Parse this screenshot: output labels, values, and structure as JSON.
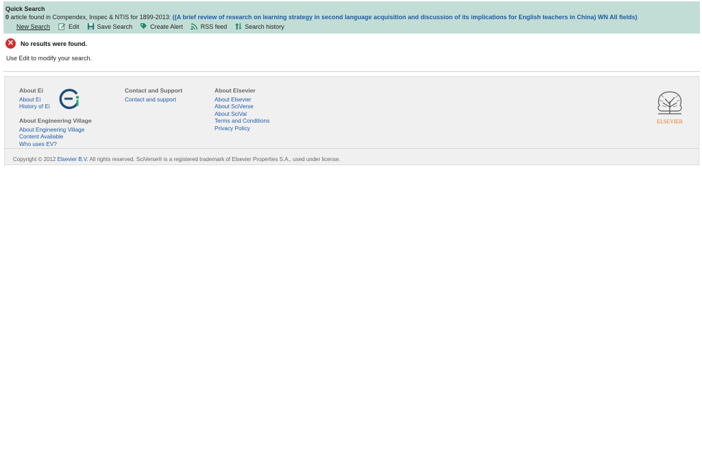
{
  "header": {
    "title": "Quick Search",
    "count": "0",
    "summary_text": " article found in Compendex, Inspec & NTIS for 1899-2013: ",
    "query": "((A brief review of research on learning strategy in second language acquisition and discussion of its implications for English teachers in China) WN All fields)"
  },
  "toolbar": {
    "new_search": "New Search",
    "edit": "Edit",
    "save_search": "Save Search",
    "create_alert": "Create Alert",
    "rss_feed": "RSS feed",
    "search_history": "Search history"
  },
  "message": {
    "error": "No results were found.",
    "hint": "Use Edit to modify your search."
  },
  "footer": {
    "about_ei": {
      "heading": "About Ei",
      "links": [
        "About Ei",
        "History of Ei"
      ]
    },
    "about_ev": {
      "heading": "About Engineering Village",
      "links": [
        "About Engineering Village",
        "Content Available",
        "Who uses EV?"
      ]
    },
    "contact": {
      "heading": "Contact and Support",
      "links": [
        "Contact and support"
      ]
    },
    "about_elsevier": {
      "heading": "About Elsevier",
      "links": [
        "About Elsevier",
        "About SciVerse",
        "About SciVal",
        "Terms and Conditions",
        "Privacy Policy"
      ]
    },
    "elsevier_logo_text": "ELSEVIER",
    "copyright_pre": "Copyright © 2012 ",
    "copyright_link": "Elsevier B.V.",
    "copyright_post": " All rights reserved. SciVerse® is a registered trademark of Elsevier Properties S.A., used under license."
  },
  "colors": {
    "header_bg": "#c2ddd6",
    "link": "#1f5aa6",
    "error": "#d42b2b",
    "elsevier_orange": "#e9711c"
  }
}
